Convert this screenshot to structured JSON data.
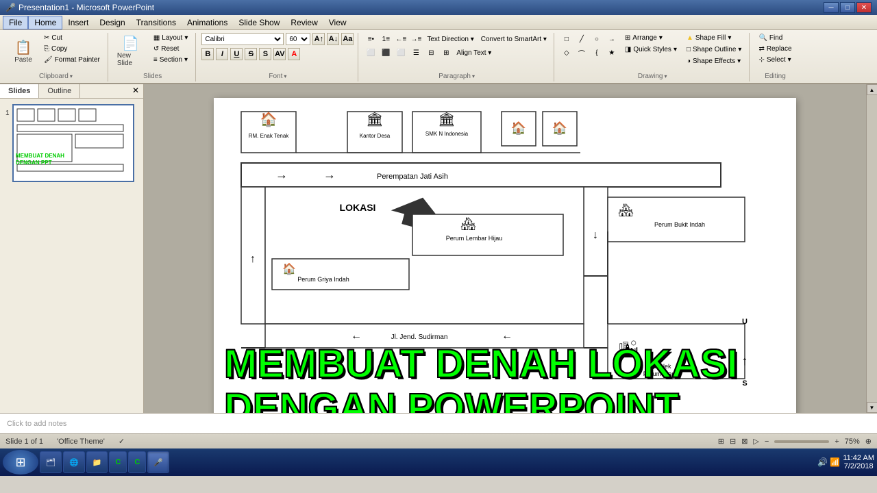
{
  "titlebar": {
    "title": "Presentation1 - Microsoft PowerPoint",
    "min_btn": "─",
    "max_btn": "□",
    "close_btn": "✕"
  },
  "menubar": {
    "items": [
      "File",
      "Home",
      "Insert",
      "Design",
      "Transitions",
      "Animations",
      "Slide Show",
      "Review",
      "View"
    ]
  },
  "ribbon": {
    "active_tab": "Home",
    "groups": {
      "clipboard": {
        "label": "Clipboard",
        "paste_label": "Paste",
        "cut_label": "Cut",
        "copy_label": "Copy",
        "format_label": "Format Painter"
      },
      "slides": {
        "label": "Slides",
        "new_slide_label": "New Slide",
        "layout_label": "Layout",
        "reset_label": "Reset",
        "section_label": "Section"
      },
      "font": {
        "label": "Font",
        "font_name": "Calibri",
        "font_size": "60",
        "bold": "B",
        "italic": "I",
        "underline": "U",
        "strikethrough": "S"
      },
      "paragraph": {
        "label": "Paragraph"
      },
      "drawing": {
        "label": "Drawing",
        "arrange_label": "Arrange",
        "quick_styles_label": "Quick Styles",
        "shape_fill_label": "Shape Fill",
        "shape_outline_label": "Shape Outline",
        "shape_effects_label": "Shape Effects"
      },
      "editing": {
        "label": "Editing",
        "find_label": "Find",
        "replace_label": "Replace",
        "select_label": "Select"
      }
    }
  },
  "slide_panel": {
    "tabs": [
      "Slides",
      "Outline"
    ],
    "slide_count": "1"
  },
  "slide": {
    "map": {
      "title": "LOKASI",
      "locations": [
        {
          "name": "RM. Enak Tenak",
          "icon": "🏠"
        },
        {
          "name": "Kantor Desa",
          "icon": "🏛"
        },
        {
          "name": "SMK N Indonesia",
          "icon": "🏛"
        },
        {
          "name": "Perum Bukit Indah",
          "icon": "🏘"
        },
        {
          "name": "Perum Lembar Hijau",
          "icon": "🏘"
        },
        {
          "name": "Perum Griya Indah",
          "icon": "🏠"
        },
        {
          "name": "Komplek Perumahan",
          "icon": "🏙"
        }
      ],
      "road": "Perempatan Jati Asih",
      "road2": "Jl. Jend. Sudirman"
    }
  },
  "overlay": {
    "line1": "MEMBUAT DENAH LOKASI",
    "line2": "DENGAN POWERPOINT"
  },
  "statusbar": {
    "slide_info": "Slide 1 of 1",
    "theme": "'Office Theme'",
    "zoom": "75%",
    "fit_icon": "⊞"
  },
  "taskbar": {
    "start_icon": "⊞",
    "apps": [
      "🗂",
      "🌐",
      "📁",
      "C",
      "C",
      "🎤"
    ],
    "time": "11:42 AM",
    "date": "7/2/2018"
  },
  "notes": {
    "placeholder": "Click to add notes"
  }
}
